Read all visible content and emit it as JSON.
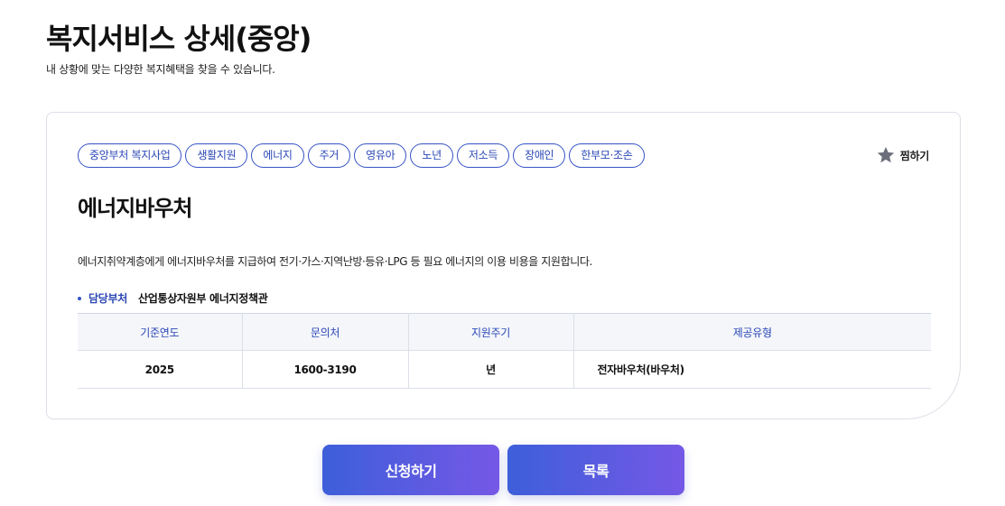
{
  "header": {
    "title": "복지서비스 상세(중앙)",
    "subtitle": "내 상황에 맞는 다양한 복지혜택을 찾을 수 있습니다."
  },
  "tags": [
    "중앙부처 복지사업",
    "생활지원",
    "에너지",
    "주거",
    "영유아",
    "노년",
    "저소득",
    "장애인",
    "한부모·조손"
  ],
  "favorite": {
    "label": "찜하기",
    "icon": "star-icon",
    "icon_color": "#6b6f7b"
  },
  "service": {
    "title": "에너지바우처",
    "description": "에너지취약계층에게 에너지바우처를 지급하여 전기·가스·지역난방·등유·LPG 등 필요 에너지의 이용 비용을 지원합니다.",
    "department_label": "담당부처",
    "department_value": "산업통상자원부 에너지정책관"
  },
  "table": {
    "headers": [
      "기준연도",
      "문의처",
      "지원주기",
      "제공유형"
    ],
    "rows": [
      [
        "2025",
        "1600-3190",
        "년",
        "전자바우처(바우처)"
      ]
    ]
  },
  "buttons": {
    "apply": "신청하기",
    "list": "목록"
  },
  "colors": {
    "accent": "#2b47b5",
    "gradient_start": "#3d5fd9",
    "gradient_end": "#7558e6"
  }
}
